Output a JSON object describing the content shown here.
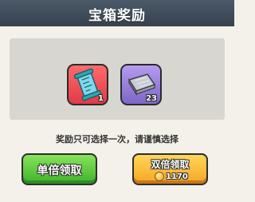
{
  "dialog": {
    "title": "宝箱奖励"
  },
  "rewards": [
    {
      "icon": "blueprint-scroll-icon",
      "count": "1",
      "frame_color": "#e03b45"
    },
    {
      "icon": "steel-plate-icon",
      "count": "23",
      "frame_color": "#7e66c7"
    }
  ],
  "notice": "奖励只可选择一次，请谨慎选择",
  "buttons": {
    "single": {
      "label": "单倍领取",
      "color": "#3fb22c"
    },
    "double": {
      "label": "双倍领取",
      "cost_icon": "coin-icon",
      "cost": "1170",
      "color": "#f5a623"
    }
  }
}
